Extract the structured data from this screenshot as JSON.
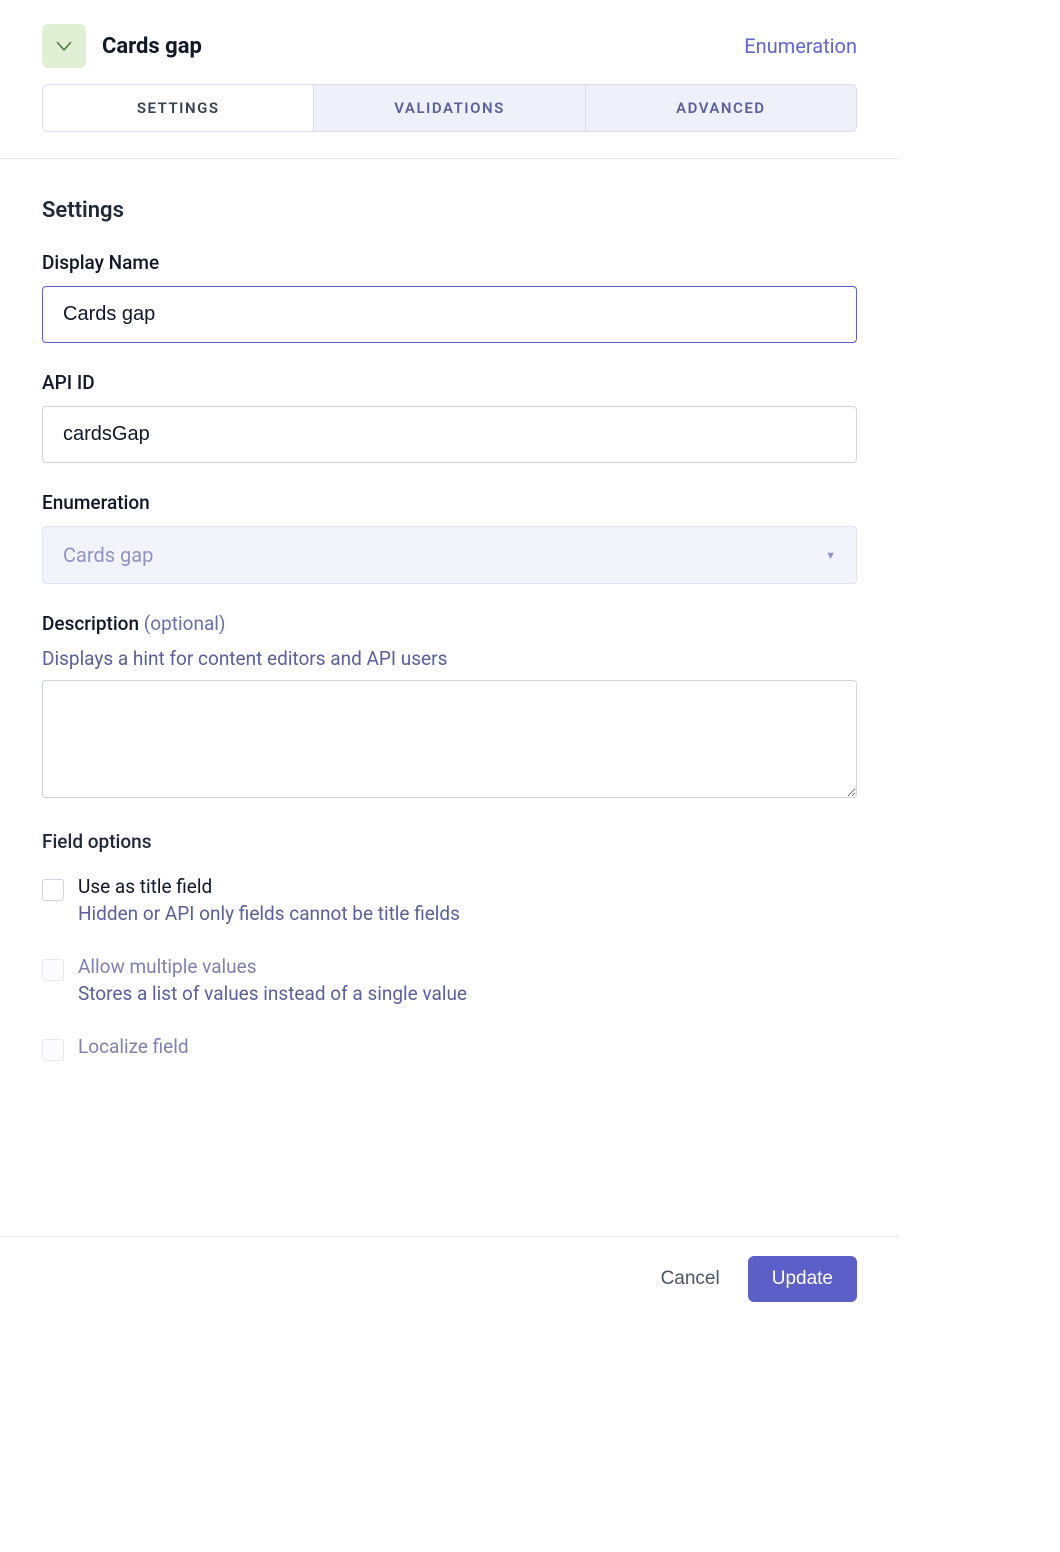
{
  "header": {
    "title": "Cards gap",
    "type": "Enumeration",
    "icon": "chevron-down-triangle"
  },
  "tabs": {
    "items": [
      {
        "label": "SETTINGS",
        "active": true
      },
      {
        "label": "VALIDATIONS",
        "active": false
      },
      {
        "label": "ADVANCED",
        "active": false
      }
    ]
  },
  "settings": {
    "heading": "Settings",
    "display_name": {
      "label": "Display Name",
      "value": "Cards gap"
    },
    "api_id": {
      "label": "API ID",
      "value": "cardsGap"
    },
    "enumeration": {
      "label": "Enumeration",
      "value": "Cards gap"
    },
    "description": {
      "label": "Description",
      "optional": "(optional)",
      "hint": "Displays a hint for content editors and API users",
      "value": ""
    },
    "field_options": {
      "heading": "Field options",
      "items": [
        {
          "label": "Use as title field",
          "desc": "Hidden or API only fields cannot be title fields",
          "disabled": false
        },
        {
          "label": "Allow multiple values",
          "desc": "Stores a list of values instead of a single value",
          "disabled": true
        },
        {
          "label": "Localize field",
          "desc": "",
          "disabled": true
        }
      ]
    }
  },
  "footer": {
    "cancel": "Cancel",
    "update": "Update"
  }
}
